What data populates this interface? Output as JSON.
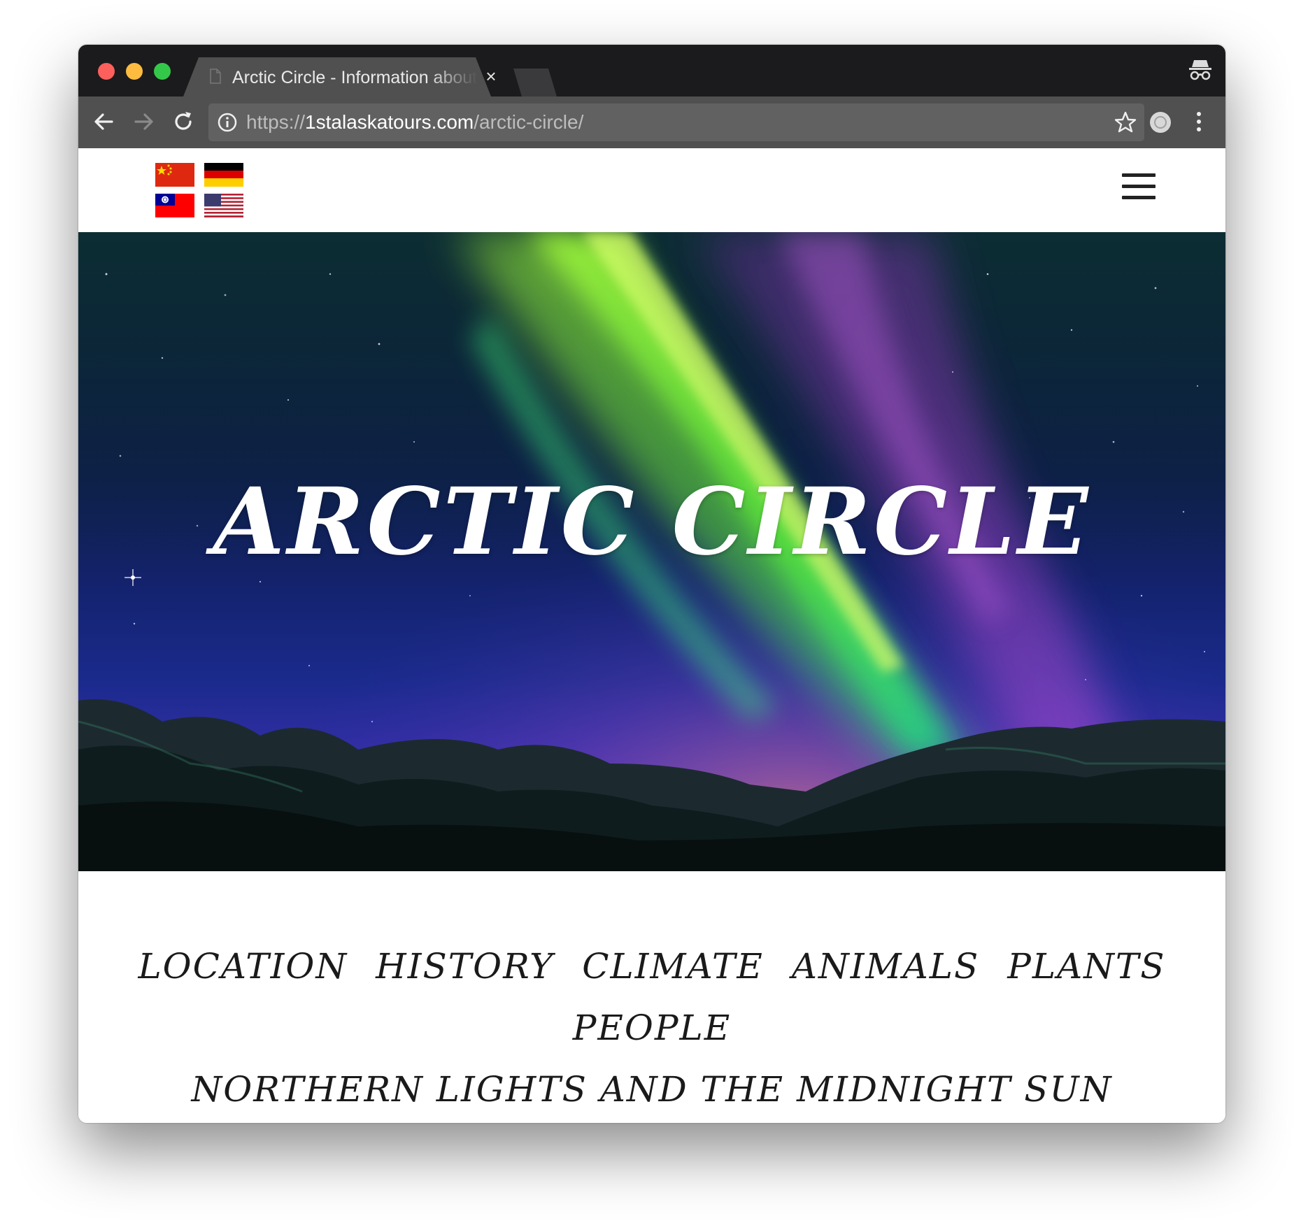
{
  "browser": {
    "tab_title": "Arctic Circle - Information about the Arctic Circle",
    "tab_close": "×",
    "url_scheme": "https://",
    "url_host": "1stalaskatours.com",
    "url_path": "/arctic-circle/"
  },
  "site": {
    "flags": [
      {
        "name": "china",
        "colors": [
          "#de2910",
          "#ffde00"
        ]
      },
      {
        "name": "germany",
        "colors": [
          "#000000",
          "#dd0000",
          "#ffce00"
        ]
      },
      {
        "name": "taiwan",
        "colors": [
          "#fe0000",
          "#000095",
          "#ffffff"
        ]
      },
      {
        "name": "usa",
        "colors": [
          "#b22234",
          "#ffffff",
          "#3c3b6e"
        ]
      }
    ],
    "hero_title": "ARCTIC CIRCLE",
    "nav": {
      "location": "LOCATION",
      "history": "HISTORY",
      "climate": "CLIMATE",
      "animals": "ANIMALS",
      "plants": "PLANTS",
      "people": "PEOPLE",
      "northern_lights": "NORTHERN LIGHTS AND THE MIDNIGHT SUN"
    }
  },
  "colors": {
    "aurora_green": "#7dff2a",
    "aurora_purple": "#8a3cc8",
    "sky_blue": "#1a2a8c"
  }
}
